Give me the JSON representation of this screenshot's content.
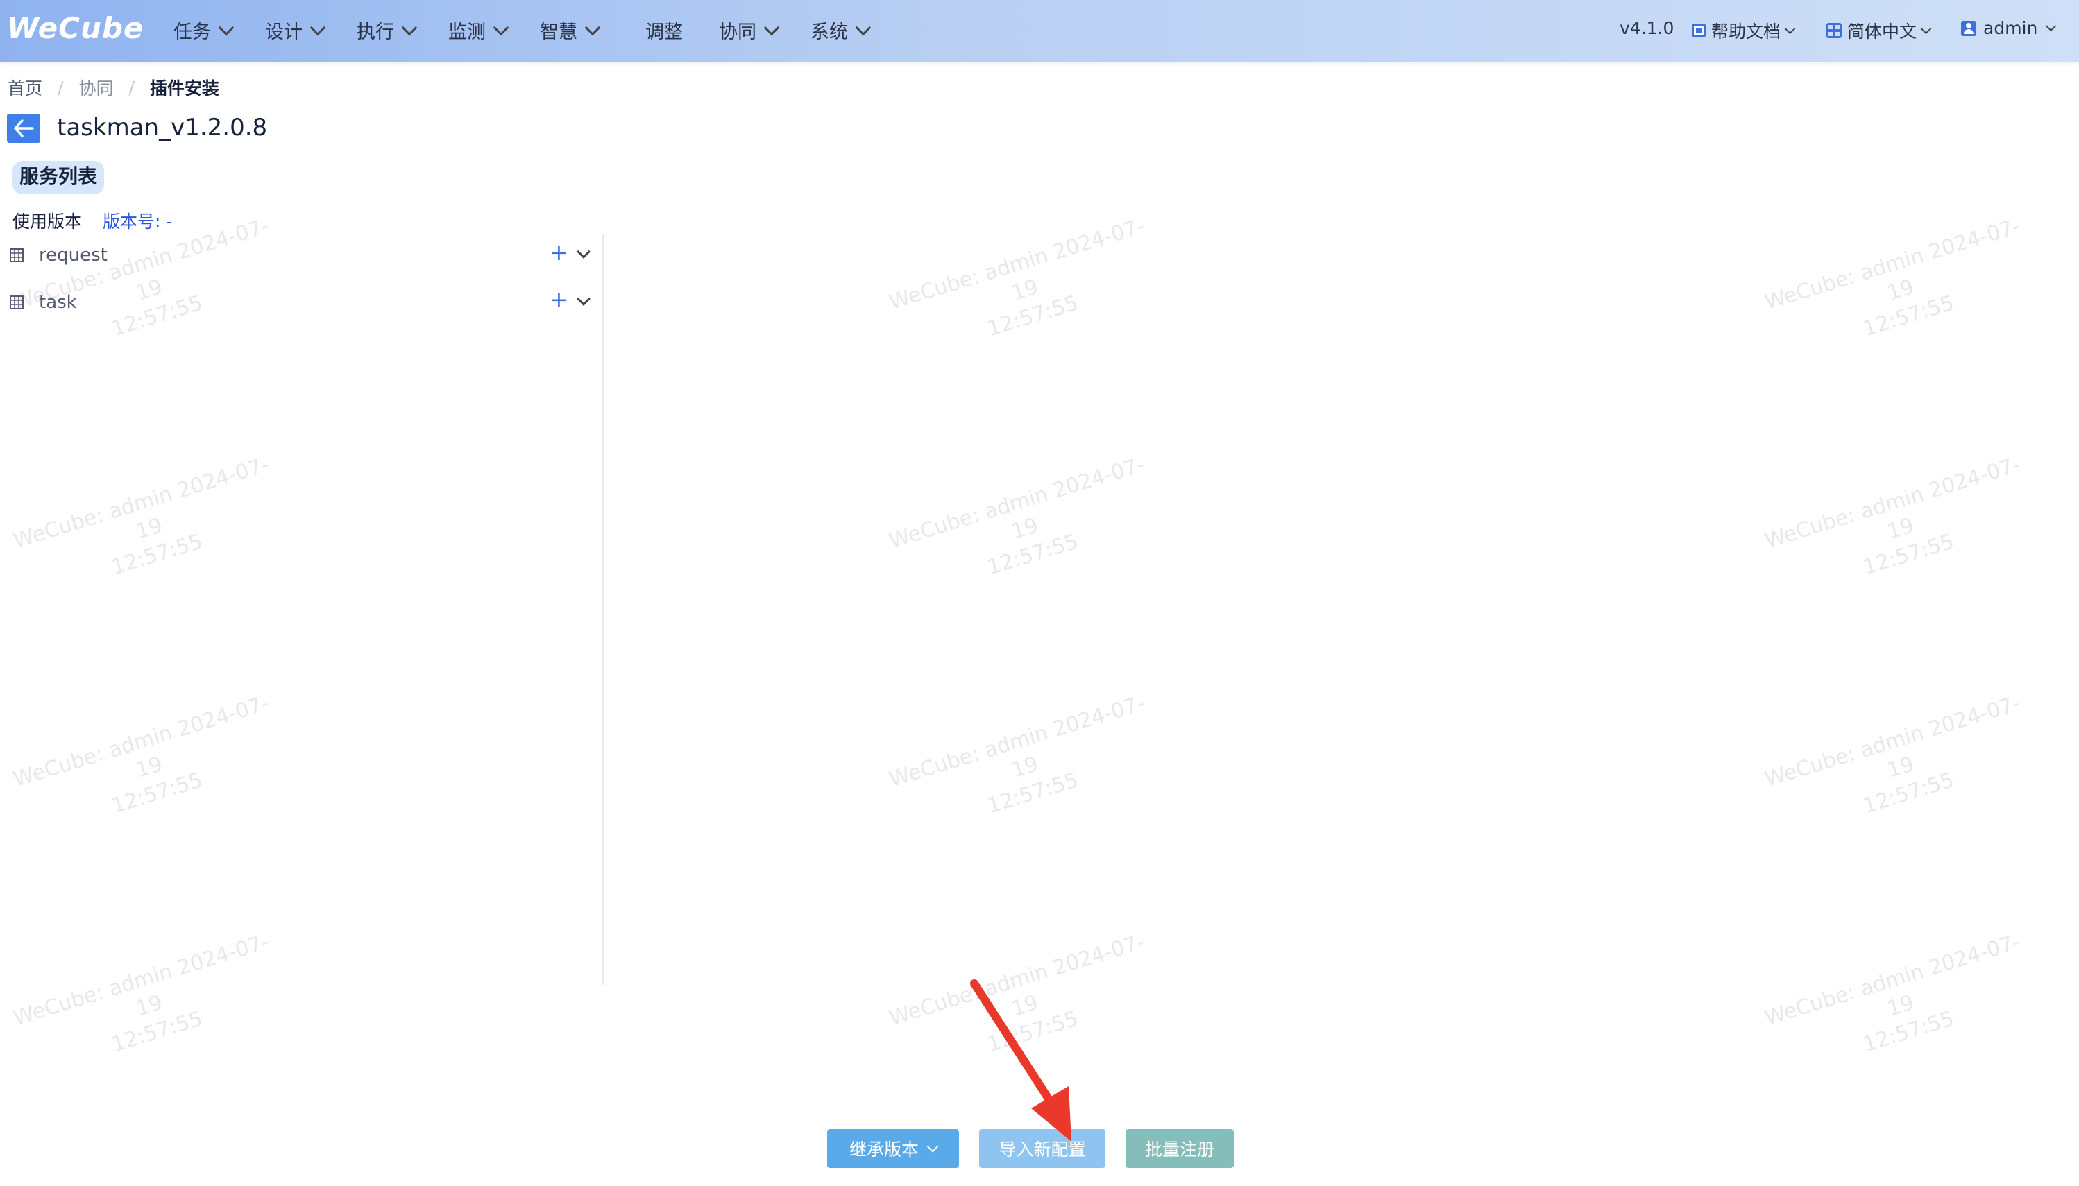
{
  "header": {
    "logo": "WeCube",
    "nav": [
      "任务",
      "设计",
      "执行",
      "监测",
      "智慧",
      "调整",
      "协同",
      "系统"
    ],
    "version": "v4.1.0",
    "help": "帮助文档",
    "language": "简体中文",
    "user": "admin"
  },
  "breadcrumb": [
    "首页",
    "协同",
    "插件安装"
  ],
  "page": {
    "title": "taskman_v1.2.0.8",
    "section_title": "服务列表",
    "version_label": "使用版本",
    "version_link": "版本号: -"
  },
  "services": [
    {
      "name": "request"
    },
    {
      "name": "task"
    }
  ],
  "watermark": {
    "line1": "WeCube: admin 2024-07-19",
    "line2": "12:57:55"
  },
  "actions": {
    "inherit": "继承版本",
    "import": "导入新配置",
    "batch_register": "批量注册"
  },
  "colors": {
    "accent": "#3d6fe0",
    "annotation_arrow": "#e8392c"
  }
}
